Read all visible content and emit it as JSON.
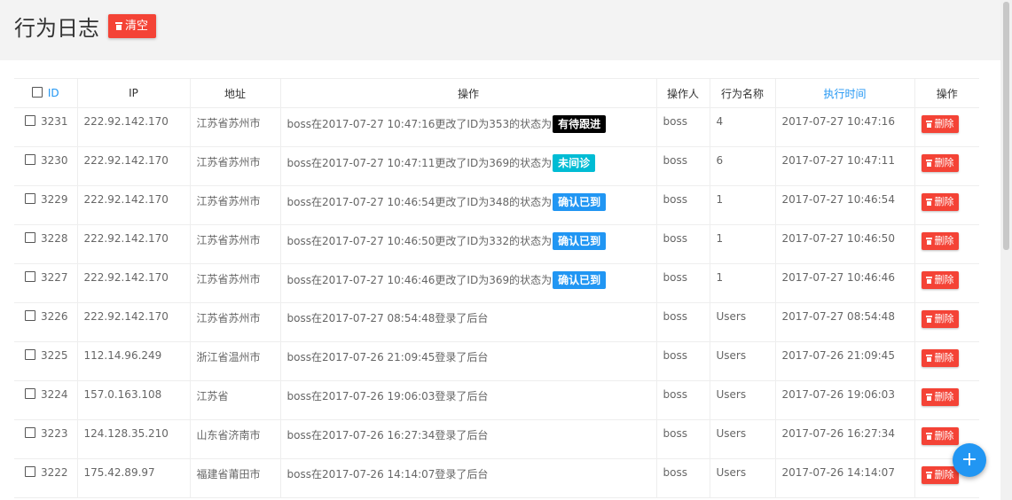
{
  "header": {
    "title": "行为日志",
    "clear_label": "清空"
  },
  "columns": {
    "id": "ID",
    "ip": "IP",
    "address": "地址",
    "operation": "操作",
    "operator": "操作人",
    "action_name": "行为名称",
    "exec_time": "执行时间",
    "actions": "操作"
  },
  "colors": {
    "accent": "#2196f3",
    "danger": "#f44336",
    "badge_black": "#000000",
    "badge_cyan": "#00bcd4",
    "badge_blue": "#2196f3"
  },
  "rows": [
    {
      "id": "3231",
      "ip": "222.92.142.170",
      "address": "江苏省苏州市",
      "op": "boss在2017-07-27 10:47:16更改了ID为353的状态为",
      "badge": "有待跟进",
      "badge_color": "#000000",
      "operator": "boss",
      "action": "4",
      "time": "2017-07-27 10:47:16",
      "delete": "删除"
    },
    {
      "id": "3230",
      "ip": "222.92.142.170",
      "address": "江苏省苏州市",
      "op": "boss在2017-07-27 10:47:11更改了ID为369的状态为",
      "badge": "未间诊",
      "badge_color": "#00bcd4",
      "operator": "boss",
      "action": "6",
      "time": "2017-07-27 10:47:11",
      "delete": "删除"
    },
    {
      "id": "3229",
      "ip": "222.92.142.170",
      "address": "江苏省苏州市",
      "op": "boss在2017-07-27 10:46:54更改了ID为348的状态为",
      "badge": "确认已到",
      "badge_color": "#2196f3",
      "operator": "boss",
      "action": "1",
      "time": "2017-07-27 10:46:54",
      "delete": "删除"
    },
    {
      "id": "3228",
      "ip": "222.92.142.170",
      "address": "江苏省苏州市",
      "op": "boss在2017-07-27 10:46:50更改了ID为332的状态为",
      "badge": "确认已到",
      "badge_color": "#2196f3",
      "operator": "boss",
      "action": "1",
      "time": "2017-07-27 10:46:50",
      "delete": "删除"
    },
    {
      "id": "3227",
      "ip": "222.92.142.170",
      "address": "江苏省苏州市",
      "op": "boss在2017-07-27 10:46:46更改了ID为369的状态为",
      "badge": "确认已到",
      "badge_color": "#2196f3",
      "operator": "boss",
      "action": "1",
      "time": "2017-07-27 10:46:46",
      "delete": "删除"
    },
    {
      "id": "3226",
      "ip": "222.92.142.170",
      "address": "江苏省苏州市",
      "op": "boss在2017-07-27 08:54:48登录了后台",
      "badge": "",
      "badge_color": "",
      "operator": "boss",
      "action": "Users",
      "time": "2017-07-27 08:54:48",
      "delete": "删除"
    },
    {
      "id": "3225",
      "ip": "112.14.96.249",
      "address": "浙江省温州市",
      "op": "boss在2017-07-26 21:09:45登录了后台",
      "badge": "",
      "badge_color": "",
      "operator": "boss",
      "action": "Users",
      "time": "2017-07-26 21:09:45",
      "delete": "删除"
    },
    {
      "id": "3224",
      "ip": "157.0.163.108",
      "address": "江苏省",
      "op": "boss在2017-07-26 19:06:03登录了后台",
      "badge": "",
      "badge_color": "",
      "operator": "boss",
      "action": "Users",
      "time": "2017-07-26 19:06:03",
      "delete": "删除"
    },
    {
      "id": "3223",
      "ip": "124.128.35.210",
      "address": "山东省济南市",
      "op": "boss在2017-07-26 16:27:34登录了后台",
      "badge": "",
      "badge_color": "",
      "operator": "boss",
      "action": "Users",
      "time": "2017-07-26 16:27:34",
      "delete": "删除"
    },
    {
      "id": "3222",
      "ip": "175.42.89.97",
      "address": "福建省莆田市",
      "op": "boss在2017-07-26 14:14:07登录了后台",
      "badge": "",
      "badge_color": "",
      "operator": "boss",
      "action": "Users",
      "time": "2017-07-26 14:14:07",
      "delete": "删除"
    }
  ],
  "fab": {
    "label": "+"
  }
}
